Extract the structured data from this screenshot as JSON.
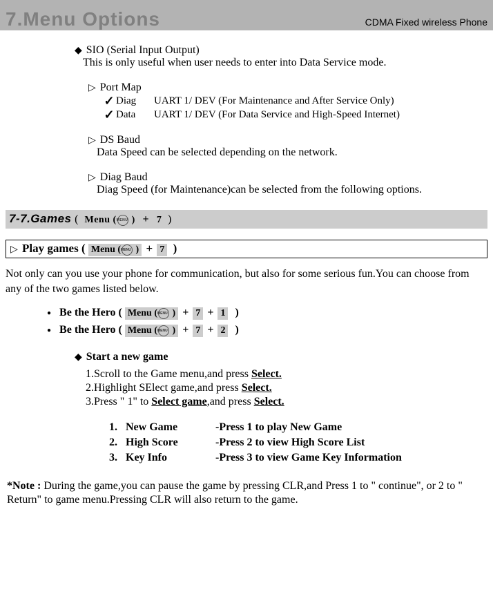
{
  "header": {
    "title": "7.Menu Options",
    "subtitle": "CDMA Fixed wireless Phone"
  },
  "sio": {
    "title": "SIO (Serial Input Output)",
    "desc": "This is only useful when user needs to enter into Data Service mode.",
    "portmap": {
      "title": "Port Map",
      "rows": [
        {
          "label": "Diag",
          "val": "UART 1/ DEV  (For Maintenance and After Service Only)"
        },
        {
          "label": "Data",
          "val": "UART 1/ DEV  (For Data Service and High-Speed Internet)"
        }
      ]
    },
    "dsbaud": {
      "title": "DS Baud",
      "desc": "Data Speed can be selected depending on the network."
    },
    "diagbaud": {
      "title": "Diag Baud",
      "desc": "Diag Speed (for Maintenance)can be selected from the following options."
    }
  },
  "section77": {
    "title": "7-7.Games",
    "keys": {
      "menu": "Menu (",
      "menuclose": " )",
      "k7": "7"
    }
  },
  "play": {
    "title": "Play games (",
    "close": ")",
    "keys": {
      "menu": "Menu (",
      "menuclose": " )",
      "k7": "7"
    }
  },
  "intro": "Not only can you use your phone for communication, but also for some serious fun.You can choose from any of the two games listed below.",
  "games": {
    "g1": {
      "label": "Be the Hero (",
      "close": ")",
      "menu": "Menu (",
      "menuclose": " )",
      "k7": "7",
      "k1": "1"
    },
    "g2": {
      "label": "Be the Hero (",
      "close": ")",
      "menu": "Menu (",
      "menuclose": " )",
      "k7": "7",
      "k2": "2"
    }
  },
  "start": {
    "title": "Start a new game",
    "s1a": "1.Scroll to the Game menu,and press ",
    "s1u": "Select.",
    "s2a": "2.Highlight  SElect game,and press ",
    "s2u": "Select.",
    "s3a": "3.Press \" 1\" to ",
    "s3u1": "Select game",
    "s3b": ",and press ",
    "s3u2": "Select."
  },
  "opts": {
    "r1": {
      "n": "1.",
      "name": "New Game",
      "desc": "-Press 1 to play New Game"
    },
    "r2": {
      "n": "2.",
      "name": "High Score",
      "desc": "-Press 2 to view High Score List"
    },
    "r3": {
      "n": "3.",
      "name": "Key Info",
      "desc": "-Press 3 to view Game Key Information"
    }
  },
  "note": {
    "label": "*Note : ",
    "text": "During the game,you can pause the game by pressing CLR,and Press 1 to \" continue\", or 2 to \" Return\" to game menu.Pressing CLR will also return to the game."
  }
}
